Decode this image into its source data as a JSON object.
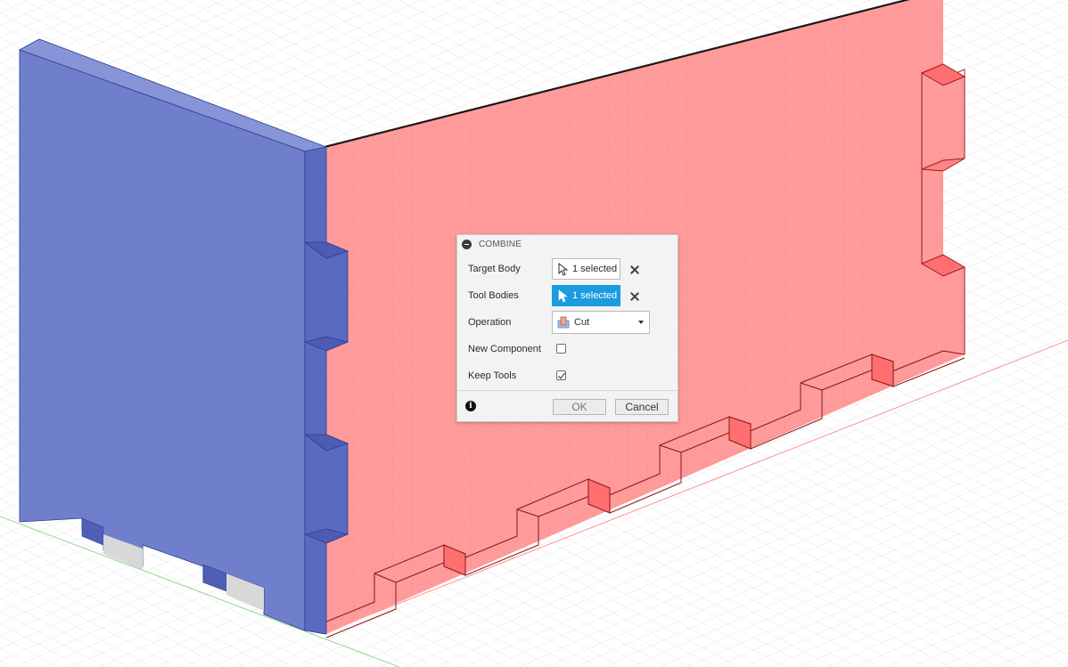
{
  "dialog": {
    "title": "COMBINE",
    "target_body": {
      "label": "Target Body",
      "value": "1 selected",
      "active": false
    },
    "tool_bodies": {
      "label": "Tool Bodies",
      "value": "1 selected",
      "active": true
    },
    "operation": {
      "label": "Operation",
      "value": "Cut"
    },
    "new_component": {
      "label": "New Component",
      "checked": false
    },
    "keep_tools": {
      "label": "Keep Tools",
      "checked": true
    },
    "ok_label": "OK",
    "cancel_label": "Cancel"
  },
  "colors": {
    "blue_body": "#6f7fcc",
    "red_body": "#ff9b9b",
    "accent": "#1a9ce0",
    "grid": "#e3e3e3"
  }
}
